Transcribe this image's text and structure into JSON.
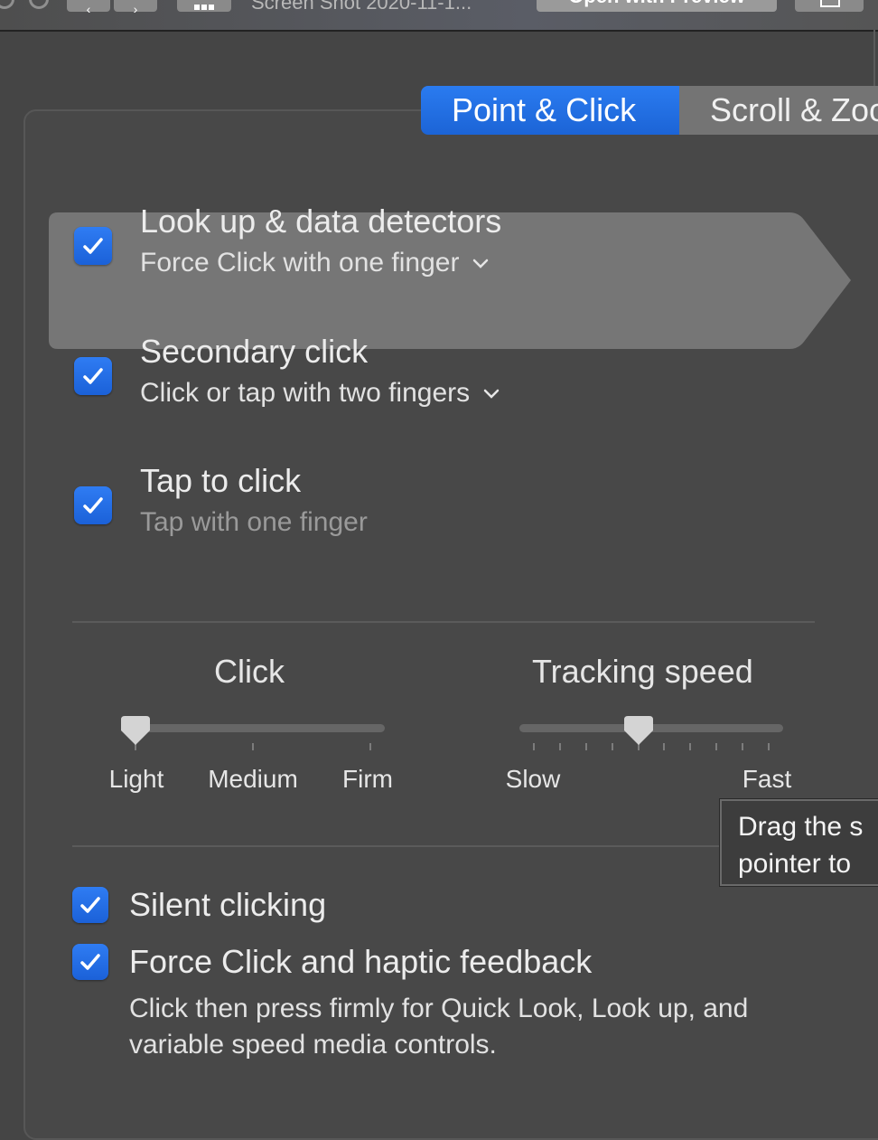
{
  "toolbar": {
    "back_icon": "chevron-left-icon",
    "forward_icon": "chevron-right-icon",
    "grid_icon": "grid-icon",
    "file_title": "Screen Shot 2020-11-1...",
    "open_with_label": "Open with Preview",
    "share_icon": "share-icon"
  },
  "tabs": [
    {
      "label": "Point & Click",
      "active": true
    },
    {
      "label": "Scroll & Zoom",
      "active": false
    }
  ],
  "options": [
    {
      "title": "Look up & data detectors",
      "subtitle": "Force Click with one finger",
      "has_dropdown": true,
      "checked": true,
      "highlighted": true
    },
    {
      "title": "Secondary click",
      "subtitle": "Click or tap with two fingers",
      "has_dropdown": true,
      "checked": true
    },
    {
      "title": "Tap to click",
      "subtitle": "Tap with one finger",
      "has_dropdown": false,
      "checked": true
    }
  ],
  "click_slider": {
    "label": "Click",
    "tick_labels": [
      "Light",
      "Medium",
      "Firm"
    ],
    "tick_count": 3,
    "value_index": 0
  },
  "tracking_slider": {
    "label": "Tracking speed",
    "tick_labels": [
      "Slow",
      "Fast"
    ],
    "tick_count": 10,
    "value_index": 4
  },
  "tooltip": {
    "line1": "Drag the s",
    "line2": "pointer to"
  },
  "bottom_options": [
    {
      "title": "Silent clicking",
      "checked": true
    },
    {
      "title": "Force Click and haptic feedback",
      "checked": true,
      "description": "Click then press firmly for Quick Look, Look up, and variable speed media controls."
    }
  ],
  "colors": {
    "accent": "#1f6ae0",
    "background": "#484848",
    "highlight": "#767676"
  }
}
